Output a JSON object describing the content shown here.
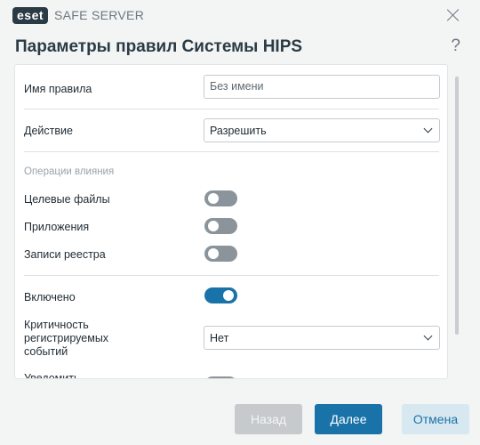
{
  "window": {
    "logo_text": "eset",
    "product_name": "SAFE SERVER"
  },
  "dialog": {
    "title": "Параметры правил Системы HIPS",
    "help_glyph": "?"
  },
  "form": {
    "rule_name_label": "Имя правила",
    "rule_name_value": "Без имени",
    "action_label": "Действие",
    "action_value": "Разрешить",
    "operations_caption": "Операции влияния",
    "target_files_label": "Целевые файлы",
    "target_files_on": false,
    "applications_label": "Приложения",
    "applications_on": false,
    "registry_label": "Записи реестра",
    "registry_on": false,
    "enabled_label": "Включено",
    "enabled_on": true,
    "severity_label_line1": "Критичность",
    "severity_label_line2": "регистрируемых",
    "severity_label_line3": "событий",
    "severity_value": "Нет",
    "notify_label_partial": "Уведомить"
  },
  "footer": {
    "back_label": "Назад",
    "next_label": "Далее",
    "cancel_label": "Отмена"
  },
  "colors": {
    "accent": "#1a73a8",
    "toggle_off": "#8a949a",
    "disabled_button": "#c6cacd"
  }
}
